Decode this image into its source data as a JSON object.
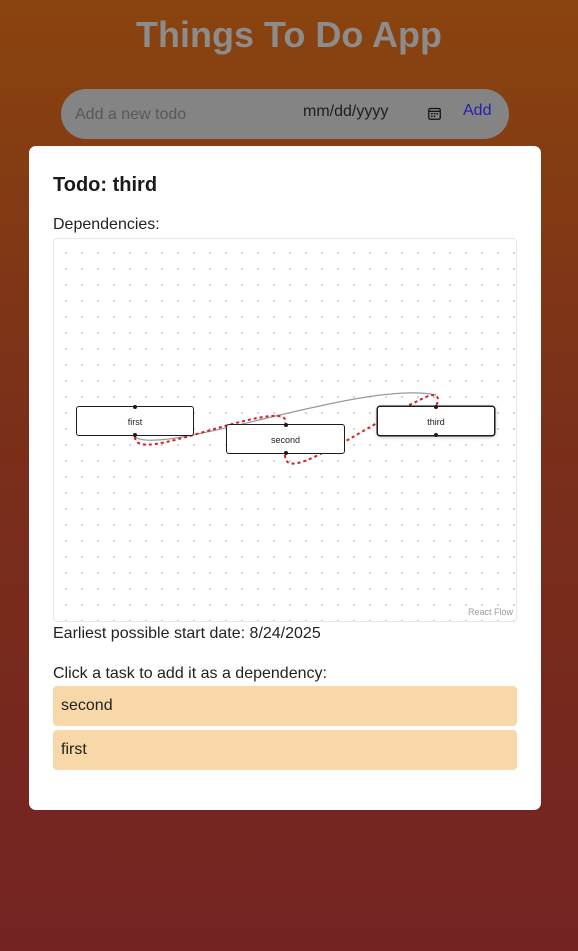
{
  "app": {
    "title": "Things To Do App"
  },
  "add_bar": {
    "input_placeholder": "Add a new todo",
    "input_value": "",
    "date_placeholder": "mm/dd/yyyy",
    "add_label": "Add"
  },
  "modal": {
    "title": "Todo: third",
    "dependencies_label": "Dependencies:",
    "graph": {
      "nodes": [
        {
          "id": "first",
          "label": "first"
        },
        {
          "id": "second",
          "label": "second"
        },
        {
          "id": "third",
          "label": "third"
        }
      ],
      "edges": [
        {
          "from": "first",
          "to": "second",
          "style": "dashed",
          "color": "#d32020"
        },
        {
          "from": "second",
          "to": "third",
          "style": "dashed",
          "color": "#d32020"
        },
        {
          "from": "first",
          "to": "third",
          "style": "solid",
          "color": "#999999"
        }
      ],
      "attribution": "React Flow"
    },
    "start_date_text": "Earliest possible start date: 8/24/2025",
    "click_label": "Click a task to add it as a dependency:",
    "tasks": [
      "second",
      "first"
    ]
  },
  "colors": {
    "background_top": "#8a440e",
    "background_bottom": "#742322",
    "task_item_bg": "#f8d7a9",
    "add_link": "#2622a8"
  }
}
